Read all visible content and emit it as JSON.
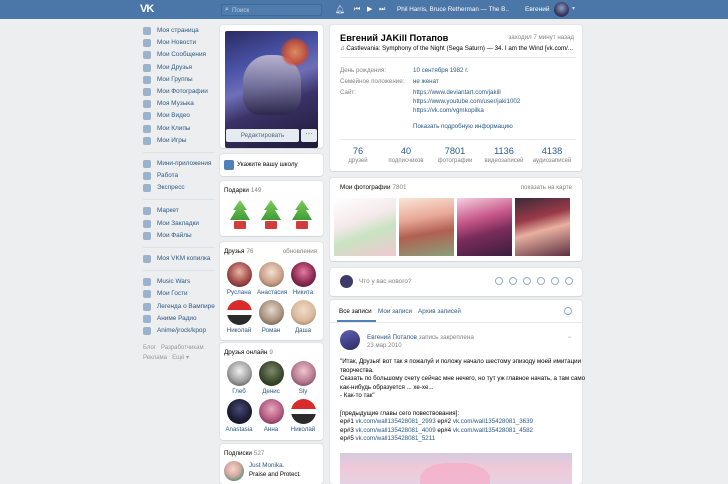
{
  "topbar": {
    "logo_icon": "vk-logo-icon",
    "search_placeholder": "Поиск",
    "now_playing": "Phil Harris, Bruce Retherman — The B...",
    "user_name": "Евгений"
  },
  "nav": {
    "group1": [
      {
        "label": "Моя страница",
        "icon": "home-icon"
      },
      {
        "label": "Мои Новости",
        "icon": "news-icon"
      },
      {
        "label": "Мои Сообщения",
        "icon": "messages-icon"
      },
      {
        "label": "Мои Друзья",
        "icon": "friends-icon"
      },
      {
        "label": "Мои Группы",
        "icon": "groups-icon"
      },
      {
        "label": "Мои Фотографии",
        "icon": "photos-icon"
      },
      {
        "label": "Моя Музыка",
        "icon": "music-icon"
      },
      {
        "label": "Мои Видео",
        "icon": "video-icon"
      },
      {
        "label": "Мои Клипы",
        "icon": "clips-icon"
      },
      {
        "label": "Мои Игры",
        "icon": "games-icon"
      }
    ],
    "group2": [
      {
        "label": "Мини-приложения",
        "icon": "apps-icon"
      },
      {
        "label": "Работа",
        "icon": "work-icon"
      },
      {
        "label": "Экспресс",
        "icon": "express-icon"
      }
    ],
    "group3": [
      {
        "label": "Маркет",
        "icon": "market-icon"
      },
      {
        "label": "Мои Закладки",
        "icon": "bookmarks-icon"
      },
      {
        "label": "Мои Файлы",
        "icon": "files-icon"
      }
    ],
    "group4": [
      {
        "label": "Моя VKM копилка",
        "icon": "piggy-bank-icon"
      }
    ],
    "group5": [
      {
        "label": "Music Wars",
        "icon": "group-icon"
      },
      {
        "label": "Мои Гости",
        "icon": "guests-icon"
      },
      {
        "label": "Легенда о Вампире",
        "icon": "group-icon"
      },
      {
        "label": "Аниме Радио",
        "icon": "group-icon"
      },
      {
        "label": "Anime/jrock/kpop",
        "icon": "group-icon"
      }
    ],
    "footer": [
      "Блог",
      "Разработчикам",
      "Реклама",
      "Ещё"
    ]
  },
  "profile_photo": {
    "edit_label": "Редактировать",
    "more_label": "···"
  },
  "school": {
    "label": "Укажите вашу школу"
  },
  "gifts": {
    "title": "Подарки",
    "count": "149"
  },
  "friends": {
    "title": "Друзья",
    "count": "76",
    "updates": "обновления",
    "list": [
      "Руслана",
      "Анастасия",
      "Никита",
      "Николай",
      "Роман",
      "Даша"
    ]
  },
  "online": {
    "title": "Друзья онлайн",
    "count": "9",
    "list": [
      "Глеб",
      "Денис",
      "Sly",
      "Anastasia",
      "Анна",
      "Николай"
    ]
  },
  "subs": {
    "title": "Подписки",
    "count": "527",
    "name": "Just Monika.",
    "desc": "Praise and Protect."
  },
  "profile": {
    "name": "Евгений JAKill Потапов",
    "last_seen": "заходил 7 минут назад",
    "activity": "Castlevania: Symphony of the Night (Sega Saturn) — 34. I am the Wind [vk.com/...",
    "birthday_label": "День рождения:",
    "birthday": "10 сентября 1982 г.",
    "status_label": "Семейное положение:",
    "status": "не женат",
    "site_label": "Сайт:",
    "sites": [
      "https://www.deviantart.com/jakill",
      "https://www.youtube.com/user/jaki1002",
      "https://vk.com/vgmkopilka"
    ],
    "show_more": "Показать подробную информацию",
    "counters": [
      {
        "num": "76",
        "label": "друзей"
      },
      {
        "num": "40",
        "label": "подписчиков"
      },
      {
        "num": "7801",
        "label": "фотографии"
      },
      {
        "num": "1136",
        "label": "видеозаписей"
      },
      {
        "num": "4138",
        "label": "аудиозаписей"
      }
    ]
  },
  "photos": {
    "title": "Мои фотографии",
    "count": "7801",
    "map_link": "показать на карте"
  },
  "post_box": {
    "placeholder": "Что у вас нового?"
  },
  "wall": {
    "tabs": [
      "Все записи",
      "Мои записи",
      "Архив записей"
    ],
    "post": {
      "author": "Евгений Потапов",
      "pinned": "запись закреплена",
      "date": "23 мар 2010",
      "lines": [
        "\"Итак, Друзья! вот так я пожалуй и положу начало шестому эпизоду моей имитации",
        "творчества.",
        "Сказать по большому счету сейчас мне нечего, но тут уж главное начать, а там само",
        "как-нибудь образуется ... хе-хе...",
        "- Как-то так\"",
        "",
        "[предыдущие главы сего повествования]:"
      ],
      "episodes": [
        {
          "prefix": "ep#1 ",
          "link1": "vk.com/wall135428081_2993",
          "mid": " ep#2 ",
          "link2": "vk.com/wall135428081_3639"
        },
        {
          "prefix": "ep#3 ",
          "link1": "vk.com/wall135428081_4009",
          "mid": " ep#4 ",
          "link2": "vk.com/wall135428081_4582"
        },
        {
          "prefix": "ep#5 ",
          "link1": "vk.com/wall135428081_5211",
          "mid": "",
          "link2": ""
        }
      ]
    }
  }
}
